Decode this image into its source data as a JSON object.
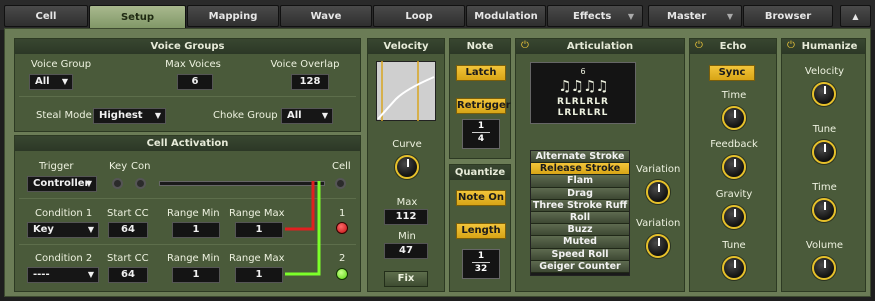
{
  "tabs": {
    "cell": "Cell",
    "setup": "Setup",
    "mapping": "Mapping",
    "wave": "Wave",
    "loop": "Loop",
    "modulation": "Modulation",
    "effects": "Effects",
    "master": "Master",
    "browser": "Browser"
  },
  "voice_groups": {
    "title": "Voice Groups",
    "voice_group_label": "Voice Group",
    "voice_group_value": "All",
    "max_voices_label": "Max Voices",
    "max_voices_value": "6",
    "voice_overlap_label": "Voice Overlap",
    "voice_overlap_value": "128",
    "steal_mode_label": "Steal Mode",
    "steal_mode_value": "Highest",
    "choke_group_label": "Choke Group",
    "choke_group_value": "All"
  },
  "cell_activation": {
    "title": "Cell Activation",
    "trigger_label": "Trigger",
    "key_label": "Key",
    "con_label": "Con",
    "cell_label": "Cell",
    "trigger_value": "Controller",
    "condition1": {
      "label": "Condition 1",
      "value": "Key",
      "start_cc_label": "Start CC",
      "start_cc": "64",
      "range_min_label": "Range Min",
      "range_min": "1",
      "range_max_label": "Range Max",
      "range_max": "1",
      "indicator": "1"
    },
    "condition2": {
      "label": "Condition 2",
      "value": "----",
      "start_cc_label": "Start CC",
      "start_cc": "64",
      "range_min_label": "Range Min",
      "range_min": "1",
      "range_max_label": "Range Max",
      "range_max": "1",
      "indicator": "2"
    }
  },
  "velocity": {
    "title": "Velocity",
    "curve_label": "Curve",
    "max_label": "Max",
    "max_value": "112",
    "min_label": "Min",
    "min_value": "47",
    "fix_label": "Fix"
  },
  "note": {
    "title": "Note",
    "latch": "Latch",
    "retrigger": "Retrigger",
    "frac_num": "1",
    "frac_den": "4"
  },
  "quantize": {
    "title": "Quantize",
    "note_on": "Note On",
    "length": "Length",
    "frac_num": "1",
    "frac_den": "32"
  },
  "articulation": {
    "title": "Articulation",
    "notation_num": "6",
    "sticking1": "RLRLRLR",
    "sticking2": "LRLRLRL",
    "variation1": "Variation",
    "variation2": "Variation",
    "items": [
      "Alternate Stroke",
      "Release Stroke",
      "Flam",
      "Drag",
      "Three Stroke Ruff",
      "Roll",
      "Buzz",
      "Muted",
      "Speed Roll",
      "Geiger Counter"
    ],
    "selected": "Release Stroke"
  },
  "echo": {
    "title": "Echo",
    "sync": "Sync",
    "time": "Time",
    "feedback": "Feedback",
    "gravity": "Gravity",
    "tune": "Tune"
  },
  "humanize": {
    "title": "Humanize",
    "velocity": "Velocity",
    "tune": "Tune",
    "time": "Time",
    "volume": "Volume"
  },
  "colors": {
    "accent": "#e8c23a",
    "panel": "#4a5a3a",
    "red": "#e02020",
    "green": "#7cff2a"
  }
}
